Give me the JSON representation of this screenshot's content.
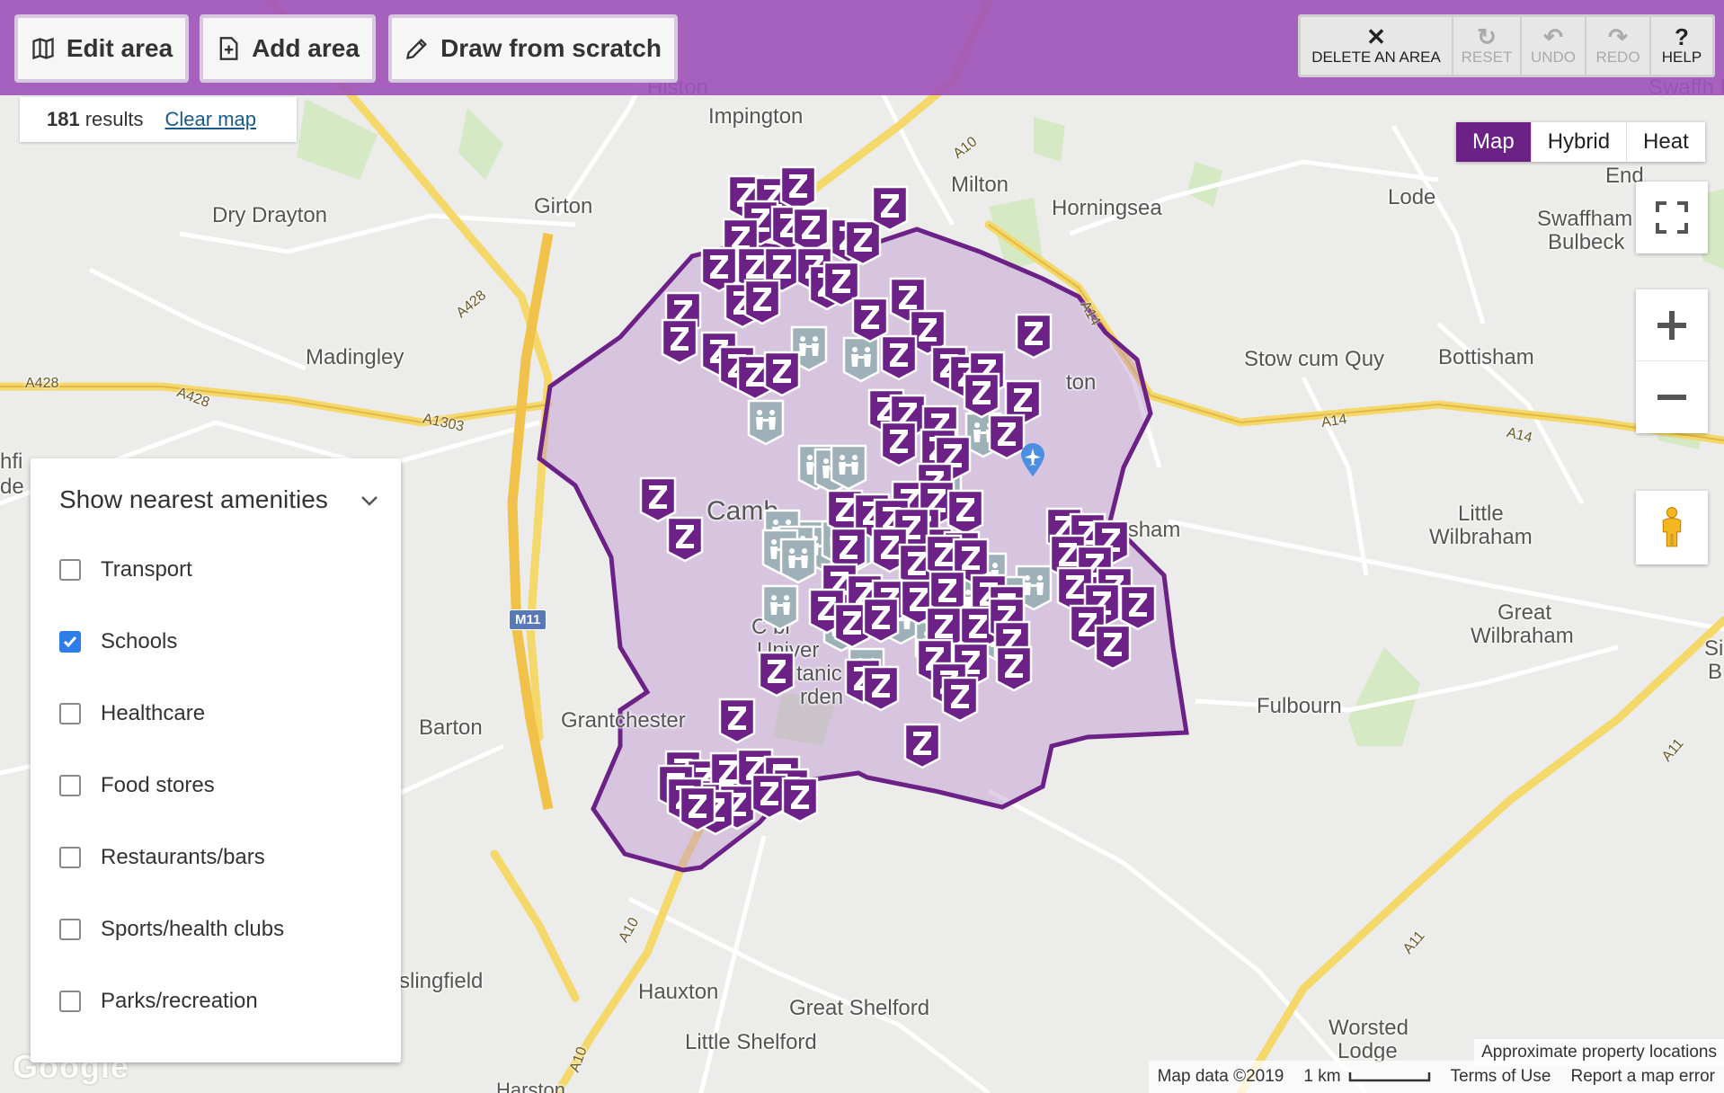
{
  "toolbar": {
    "edit_area": "Edit area",
    "add_area": "Add area",
    "draw_from_scratch": "Draw from scratch",
    "delete_an_area": "DELETE AN AREA",
    "reset": "RESET",
    "undo": "UNDO",
    "redo": "REDO",
    "help": "HELP"
  },
  "results": {
    "count": "181",
    "label": "results",
    "clear": "Clear map"
  },
  "map_type": {
    "options": [
      "Map",
      "Hybrid",
      "Heat"
    ],
    "selected": "Map"
  },
  "amenities": {
    "title": "Show nearest amenities",
    "items": [
      {
        "label": "Transport",
        "checked": false
      },
      {
        "label": "Schools",
        "checked": true
      },
      {
        "label": "Healthcare",
        "checked": false
      },
      {
        "label": "Food stores",
        "checked": false
      },
      {
        "label": "Restaurants/bars",
        "checked": false
      },
      {
        "label": "Sports/health clubs",
        "checked": false
      },
      {
        "label": "Parks/recreation",
        "checked": false
      }
    ]
  },
  "places": {
    "histon": "Histon",
    "impington": "Impington",
    "milton": "Milton",
    "horningsea": "Horningsea",
    "lode": "Lode",
    "swaffham_prior": "Swaffh Prior",
    "swaffham_bulbeck_1": "Swaffham",
    "swaffham_bulbeck_2": "Bulbeck",
    "end": "End",
    "dry_drayton": "Dry Drayton",
    "girton": "Girton",
    "madingley": "Madingley",
    "stow_cum_quy": "Stow cum Quy",
    "bottisham": "Bottisham",
    "cambridge": "Camb",
    "fen_ditton": "ton",
    "teversham": "Teversham",
    "little_wilbraham_1": "Little",
    "little_wilbraham_2": "Wilbraham",
    "great_wilbraham_1": "Great",
    "great_wilbraham_2": "Wilbraham",
    "fulbourn": "Fulbourn",
    "barton": "Barton",
    "grantchester": "Grantchester",
    "botanic_1": "C   br",
    "botanic_2": "Univer",
    "botanic_3": "tanic",
    "botanic_4": "rden",
    "haslingfield": "slingfield",
    "hauxton": "Hauxton",
    "great_shelford": "Great Shelford",
    "little_shelford": "Little Shelford",
    "worsted_lodge_1": "Worsted",
    "worsted_lodge_2": "Lodge",
    "harston": "Harston",
    "hardwick_1": "hfi",
    "hardwick_2": "de",
    "si": "Si",
    "be": "B"
  },
  "roads": {
    "a428_left": "A428",
    "a428_mid": "A428",
    "a428_diag": "A428",
    "a1303": "A1303",
    "a10_north": "A10",
    "a14_north": "A14",
    "a14_east": "A14",
    "a14_far": "A14",
    "a11_east": "A11",
    "a11_south": "A11",
    "a10_south": "A10",
    "a10_bottom": "A10",
    "m11": "M11"
  },
  "attribution": {
    "map_data": "Map data ©2019",
    "scale": "1 km",
    "terms": "Terms of Use",
    "report": "Report a map error",
    "approx": "Approximate property locations",
    "google": "Google"
  },
  "icons": {
    "edit_area": "map-edit-icon",
    "add_area": "add-area-icon",
    "draw": "pencil-icon",
    "fullscreen": "fullscreen-icon",
    "zoom_in": "zoom-in-icon",
    "zoom_out": "zoom-out-icon",
    "street_view": "pegman-icon",
    "property_marker": "zoopla-z-marker-icon",
    "school_marker": "school-marker-icon"
  },
  "colors": {
    "toolbar": "#a054b9",
    "area_fill": "#c9a8d8",
    "area_stroke": "#6b2185",
    "marker": "#6b2185",
    "school_marker": "#9fb1b8",
    "map_type_active": "#6b2185",
    "checkbox": "#2d7ee8"
  }
}
